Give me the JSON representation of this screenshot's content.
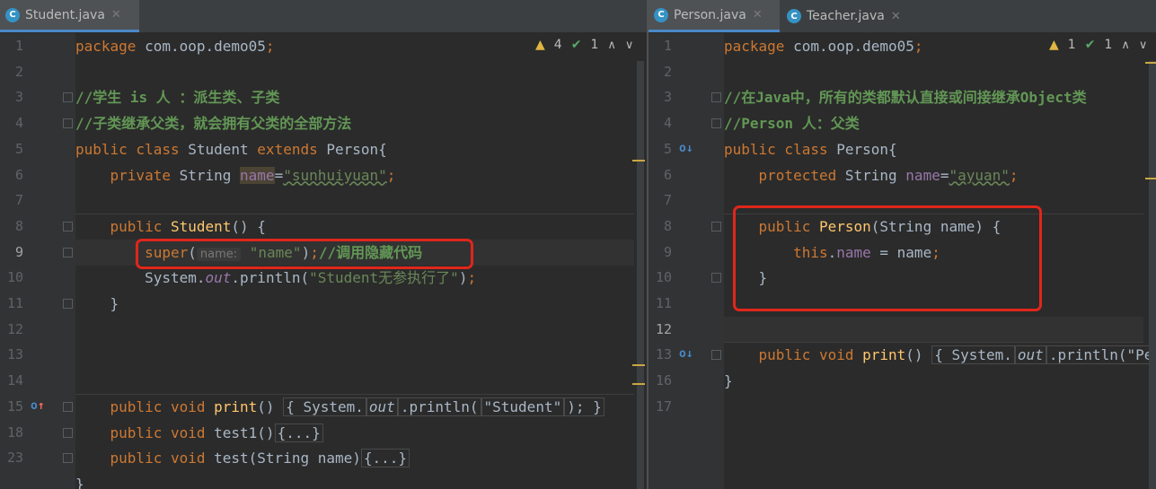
{
  "left": {
    "tabs": [
      {
        "label": "Student.java",
        "active": true,
        "icon": "java-class-icon"
      }
    ],
    "inspections": {
      "warnings": "4",
      "checks": "1"
    },
    "lines": [
      {
        "n": "1",
        "tokens": [
          [
            "kw",
            "package "
          ],
          [
            "t",
            "com.oop.demo05"
          ],
          [
            "kw",
            ";"
          ]
        ]
      },
      {
        "n": "2",
        "tokens": []
      },
      {
        "n": "3",
        "tokens": [
          [
            "cm",
            "//学生 is 人 ：派生类、子类"
          ]
        ]
      },
      {
        "n": "4",
        "tokens": [
          [
            "cm",
            "//子类继承父类，就会拥有父类的全部方法"
          ]
        ]
      },
      {
        "n": "5",
        "tokens": [
          [
            "kw",
            "public class "
          ],
          [
            "t",
            "Student "
          ],
          [
            "kw",
            "extends "
          ],
          [
            "t",
            "Person{"
          ]
        ]
      },
      {
        "n": "6",
        "tokens": [
          [
            "t",
            "    "
          ],
          [
            "kw",
            "private "
          ],
          [
            "t",
            "String "
          ],
          [
            "hlname",
            "name"
          ],
          [
            "t",
            "="
          ],
          [
            "strsq",
            "\"sunhuiyuan\""
          ],
          [
            "kw",
            ";"
          ]
        ]
      },
      {
        "n": "7",
        "tokens": []
      },
      {
        "n": "8",
        "tokens": [
          [
            "t",
            "    "
          ],
          [
            "kw",
            "public "
          ],
          [
            "fn",
            "Student"
          ],
          [
            "t",
            "() {"
          ]
        ]
      },
      {
        "n": "9",
        "tokens": [
          [
            "t",
            "        "
          ],
          [
            "kw",
            "super"
          ],
          [
            "t",
            "("
          ],
          [
            "hint",
            "name:"
          ],
          [
            "t",
            " "
          ],
          [
            "str",
            "\"name\""
          ],
          [
            "t",
            ")"
          ],
          [
            "kw",
            ";"
          ],
          [
            "cm",
            "//调用隐藏代码"
          ]
        ]
      },
      {
        "n": "10",
        "tokens": [
          [
            "t",
            "        System."
          ],
          [
            "italic",
            "out"
          ],
          [
            "t",
            ".println("
          ],
          [
            "str",
            "\"Student无参执行了\""
          ],
          [
            "t",
            ")"
          ],
          [
            "kw",
            ";"
          ]
        ]
      },
      {
        "n": "11",
        "tokens": [
          [
            "t",
            "    }"
          ]
        ]
      },
      {
        "n": "12",
        "tokens": []
      },
      {
        "n": "13",
        "tokens": []
      },
      {
        "n": "14",
        "tokens": []
      },
      {
        "n": "15",
        "tokens": [
          [
            "t",
            "    "
          ],
          [
            "kw",
            "public void "
          ],
          [
            "fn",
            "print"
          ],
          [
            "t",
            "() "
          ],
          [
            "folded",
            "{ System."
          ],
          [
            "italicf",
            "out"
          ],
          [
            "folded",
            ".println("
          ],
          [
            "strf",
            "\"Student\""
          ],
          [
            "folded",
            "); }"
          ]
        ]
      },
      {
        "n": "18",
        "tokens": [
          [
            "t",
            "    "
          ],
          [
            "kw",
            "public void "
          ],
          [
            "t",
            "test1()"
          ],
          [
            "folded",
            "{...}"
          ]
        ]
      },
      {
        "n": "23",
        "tokens": [
          [
            "t",
            "    "
          ],
          [
            "kw",
            "public void "
          ],
          [
            "t",
            "test(String name)"
          ],
          [
            "folded",
            "{...}"
          ]
        ]
      },
      {
        "n": "",
        "tokens": [
          [
            "t",
            "}"
          ]
        ]
      }
    ]
  },
  "right": {
    "tabs": [
      {
        "label": "Person.java",
        "active": true,
        "icon": "java-class-icon"
      },
      {
        "label": "Teacher.java",
        "active": false,
        "icon": "java-class-icon"
      }
    ],
    "inspections": {
      "warnings": "1",
      "checks": "1"
    },
    "lines": [
      {
        "n": "1",
        "tokens": [
          [
            "kw",
            "package "
          ],
          [
            "t",
            "com.oop.demo05"
          ],
          [
            "kw",
            ";"
          ]
        ]
      },
      {
        "n": "2",
        "tokens": []
      },
      {
        "n": "3",
        "tokens": [
          [
            "cm",
            "//在Java中，所有的类都默认直接或间接继承Object类"
          ]
        ]
      },
      {
        "n": "4",
        "tokens": [
          [
            "cm",
            "//Person 人：父类"
          ]
        ]
      },
      {
        "n": "5",
        "tokens": [
          [
            "kw",
            "public class "
          ],
          [
            "t",
            "Person{"
          ]
        ]
      },
      {
        "n": "6",
        "tokens": [
          [
            "t",
            "    "
          ],
          [
            "kw",
            "protected "
          ],
          [
            "t",
            "String "
          ],
          [
            "field",
            "name"
          ],
          [
            "t",
            "="
          ],
          [
            "strsq",
            "\"ayuan\""
          ],
          [
            "kw",
            ";"
          ]
        ]
      },
      {
        "n": "7",
        "tokens": []
      },
      {
        "n": "8",
        "tokens": [
          [
            "t",
            "    "
          ],
          [
            "kw",
            "public "
          ],
          [
            "fn",
            "Person"
          ],
          [
            "t",
            "(String name) {"
          ]
        ]
      },
      {
        "n": "9",
        "tokens": [
          [
            "t",
            "        "
          ],
          [
            "kw",
            "this"
          ],
          [
            "t",
            "."
          ],
          [
            "field",
            "name"
          ],
          [
            "t",
            " = name"
          ],
          [
            "kw",
            ";"
          ]
        ]
      },
      {
        "n": "10",
        "tokens": [
          [
            "t",
            "    }"
          ]
        ]
      },
      {
        "n": "11",
        "tokens": []
      },
      {
        "n": "12",
        "tokens": []
      },
      {
        "n": "13",
        "tokens": [
          [
            "t",
            "    "
          ],
          [
            "kw",
            "public void "
          ],
          [
            "fn",
            "print"
          ],
          [
            "t",
            "() "
          ],
          [
            "folded",
            "{ System."
          ],
          [
            "italicf",
            "out"
          ],
          [
            "folded",
            ".println(\"Pe"
          ]
        ]
      },
      {
        "n": "16",
        "tokens": [
          [
            "t",
            "}"
          ]
        ]
      },
      {
        "n": "17",
        "tokens": []
      }
    ]
  },
  "colors": {
    "accent": "#4a88c7",
    "highlight_box": "#e0261b"
  }
}
